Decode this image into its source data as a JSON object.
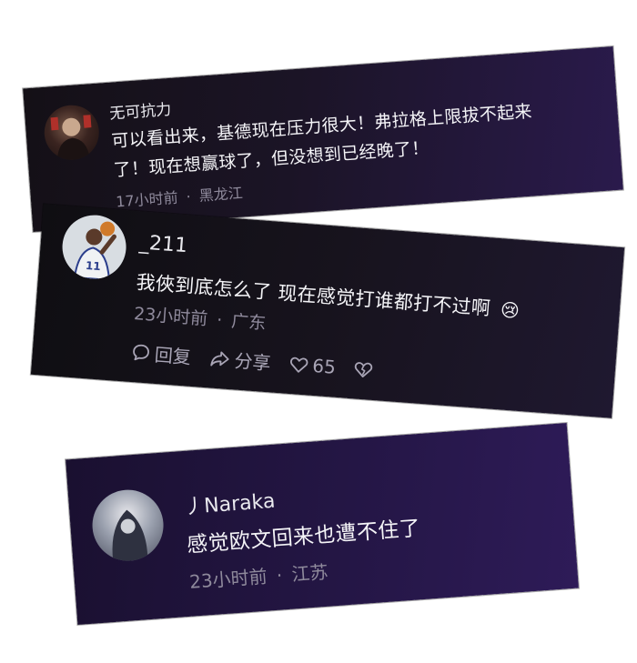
{
  "comments": [
    {
      "username": "无可抗力",
      "text_line1": "可以看出来，基德现在压力很大！弗拉格上限拔不起来",
      "text_line2": "了！现在想赢球了，但没想到已经晚了！",
      "time": "17小时前",
      "separator": "·",
      "location": "黑龙江"
    },
    {
      "username": "_211",
      "text": "我俠到底怎么了 现在感觉打谁都打不过啊",
      "emoji": "😢",
      "time": "23小时前",
      "separator": "·",
      "location": "广东",
      "actions": {
        "reply_label": "回复",
        "share_label": "分享",
        "like_count": "65"
      }
    },
    {
      "username": "丿Naraka",
      "text": "感觉欧文回来也遭不住了",
      "time": "23小时前",
      "separator": "·",
      "location": "江苏"
    }
  ],
  "colors": {
    "card_dark": "#141016",
    "card_purple": "#2a1a4c",
    "meta_text": "#8f8a9c",
    "body_text": "#f4f4f7"
  }
}
